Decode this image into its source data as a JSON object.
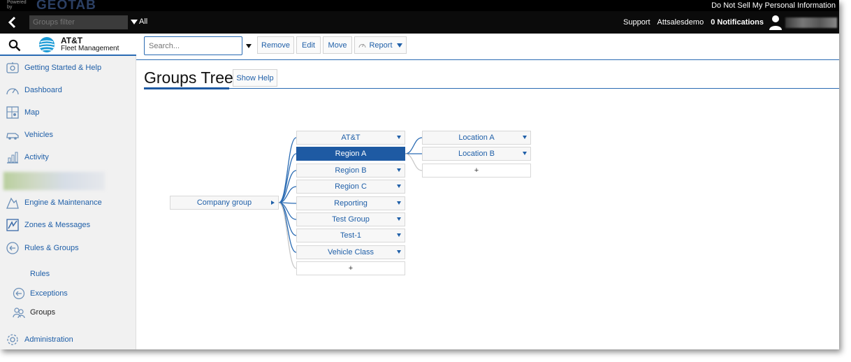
{
  "brandbar": {
    "powered": "Powered by",
    "logo": "GEOTAB",
    "privacy_link": "Do Not Sell My Personal Information"
  },
  "topnav": {
    "groups_filter_placeholder": "Groups filter",
    "all_label": "All",
    "support": "Support",
    "account": "Attsalesdemo",
    "notifications": "0 Notifications"
  },
  "sidebar": {
    "brand_line1": "AT&T",
    "brand_line2": "Fleet Management",
    "items": [
      {
        "label": "Getting Started & Help",
        "icon": "help-icon"
      },
      {
        "label": "Dashboard",
        "icon": "gauge-icon"
      },
      {
        "label": "Map",
        "icon": "map-icon"
      },
      {
        "label": "Vehicles",
        "icon": "vehicle-icon"
      },
      {
        "label": "Activity",
        "icon": "bar-chart-icon"
      },
      {
        "label": "Engine & Maintenance",
        "icon": "engine-icon"
      },
      {
        "label": "Zones & Messages",
        "icon": "zones-icon"
      },
      {
        "label": "Rules & Groups",
        "icon": "rules-icon"
      }
    ],
    "subitems": [
      {
        "label": "Rules"
      },
      {
        "label": "Exceptions",
        "icon": "exceptions-icon"
      },
      {
        "label": "Groups",
        "icon": "groups-icon"
      }
    ],
    "admin": {
      "label": "Administration",
      "icon": "gear-icon"
    }
  },
  "toolbar": {
    "search_placeholder": "Search...",
    "remove": "Remove",
    "edit": "Edit",
    "move": "Move",
    "report": "Report"
  },
  "page": {
    "title": "Groups Tree",
    "show_help": "Show Help"
  },
  "tree": {
    "root": "Company group",
    "children": [
      "AT&T",
      "Region A",
      "Region B",
      "Region C",
      "Reporting",
      "Test Group",
      "Test-1",
      "Vehicle Class"
    ],
    "selected": "Region A",
    "grandchildren": [
      "Location A",
      "Location B"
    ],
    "add_label": "+"
  },
  "colors": {
    "accent": "#1e5aa3",
    "link": "#1f5fa8",
    "topbar": "#0b0b0b"
  }
}
